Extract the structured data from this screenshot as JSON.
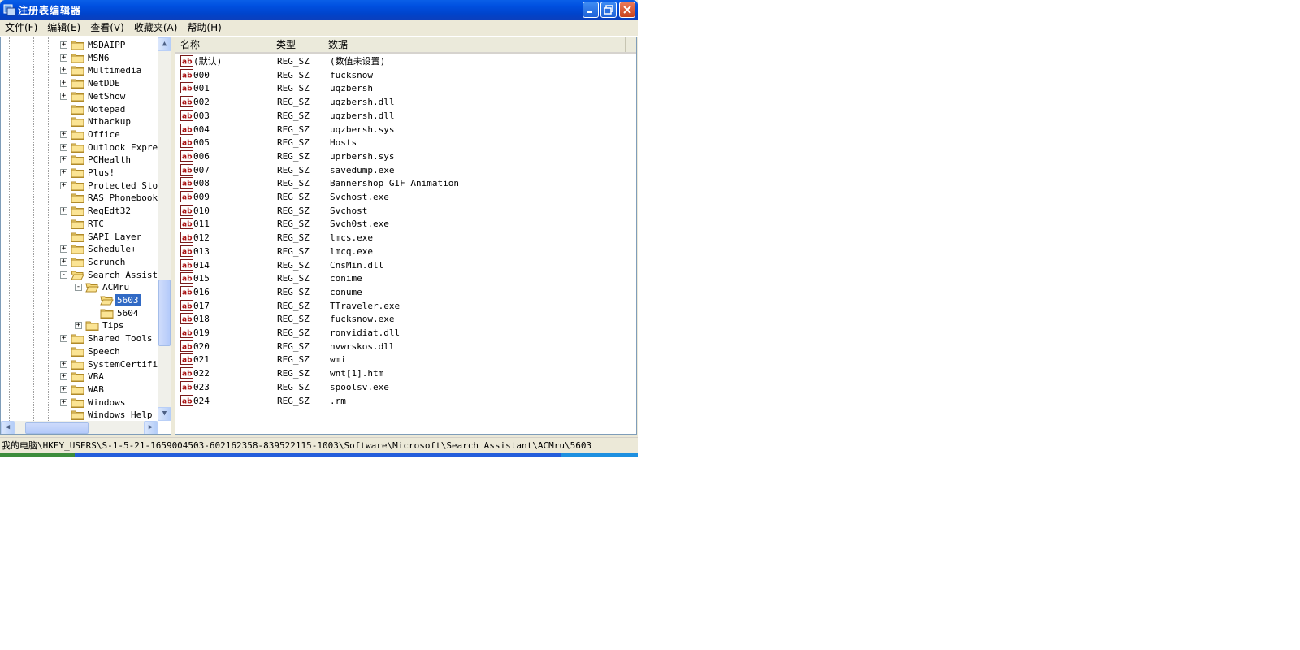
{
  "window": {
    "title": "注册表编辑器"
  },
  "menu": [
    "文件(F)",
    "编辑(E)",
    "查看(V)",
    "收藏夹(A)",
    "帮助(H)"
  ],
  "tree": {
    "items": [
      {
        "label": "MSDAIPP",
        "expander": "+"
      },
      {
        "label": "MSN6",
        "expander": "+"
      },
      {
        "label": "Multimedia",
        "expander": "+"
      },
      {
        "label": "NetDDE",
        "expander": "+"
      },
      {
        "label": "NetShow",
        "expander": "+"
      },
      {
        "label": "Notepad",
        "expander": ""
      },
      {
        "label": "Ntbackup",
        "expander": ""
      },
      {
        "label": "Office",
        "expander": "+"
      },
      {
        "label": "Outlook Express",
        "expander": "+"
      },
      {
        "label": "PCHealth",
        "expander": "+"
      },
      {
        "label": "Plus!",
        "expander": "+"
      },
      {
        "label": "Protected Stor",
        "expander": "+"
      },
      {
        "label": "RAS Phonebook",
        "expander": ""
      },
      {
        "label": "RegEdt32",
        "expander": "+"
      },
      {
        "label": "RTC",
        "expander": ""
      },
      {
        "label": "SAPI Layer",
        "expander": ""
      },
      {
        "label": "Schedule+",
        "expander": "+"
      },
      {
        "label": "Scrunch",
        "expander": "+"
      },
      {
        "label": "Search Assistant",
        "expander": "-"
      },
      {
        "label": "ACMru",
        "expander": "-"
      },
      {
        "label": "5603",
        "expander": "",
        "selected": true
      },
      {
        "label": "5604",
        "expander": ""
      },
      {
        "label": "Tips",
        "expander": "+"
      },
      {
        "label": "Shared Tools",
        "expander": "+"
      },
      {
        "label": "Speech",
        "expander": ""
      },
      {
        "label": "SystemCertificates",
        "expander": "+"
      },
      {
        "label": "VBA",
        "expander": "+"
      },
      {
        "label": "WAB",
        "expander": "+"
      },
      {
        "label": "Windows",
        "expander": "+"
      },
      {
        "label": "Windows Help",
        "expander": ""
      }
    ]
  },
  "list": {
    "columns": [
      "名称",
      "类型",
      "数据"
    ],
    "rows": [
      {
        "name": "(默认)",
        "type": "REG_SZ",
        "data": "(数值未设置)"
      },
      {
        "name": "000",
        "type": "REG_SZ",
        "data": "fucksnow"
      },
      {
        "name": "001",
        "type": "REG_SZ",
        "data": "uqzbersh"
      },
      {
        "name": "002",
        "type": "REG_SZ",
        "data": "uqzbersh.dll"
      },
      {
        "name": "003",
        "type": "REG_SZ",
        "data": "uqzbersh.dll"
      },
      {
        "name": "004",
        "type": "REG_SZ",
        "data": "uqzbersh.sys"
      },
      {
        "name": "005",
        "type": "REG_SZ",
        "data": "Hosts"
      },
      {
        "name": "006",
        "type": "REG_SZ",
        "data": "uprbersh.sys"
      },
      {
        "name": "007",
        "type": "REG_SZ",
        "data": "savedump.exe"
      },
      {
        "name": "008",
        "type": "REG_SZ",
        "data": "Bannershop GIF Animation"
      },
      {
        "name": "009",
        "type": "REG_SZ",
        "data": "Svchost.exe"
      },
      {
        "name": "010",
        "type": "REG_SZ",
        "data": "Svchost"
      },
      {
        "name": "011",
        "type": "REG_SZ",
        "data": "Svch0st.exe"
      },
      {
        "name": "012",
        "type": "REG_SZ",
        "data": "lmcs.exe"
      },
      {
        "name": "013",
        "type": "REG_SZ",
        "data": "lmcq.exe"
      },
      {
        "name": "014",
        "type": "REG_SZ",
        "data": "CnsMin.dll"
      },
      {
        "name": "015",
        "type": "REG_SZ",
        "data": "conime"
      },
      {
        "name": "016",
        "type": "REG_SZ",
        "data": "conume"
      },
      {
        "name": "017",
        "type": "REG_SZ",
        "data": "TTraveler.exe"
      },
      {
        "name": "018",
        "type": "REG_SZ",
        "data": "fucksnow.exe"
      },
      {
        "name": "019",
        "type": "REG_SZ",
        "data": "ronvidiat.dll"
      },
      {
        "name": "020",
        "type": "REG_SZ",
        "data": "nvwrskos.dll"
      },
      {
        "name": "021",
        "type": "REG_SZ",
        "data": "wmi"
      },
      {
        "name": "022",
        "type": "REG_SZ",
        "data": "wnt[1].htm"
      },
      {
        "name": "023",
        "type": "REG_SZ",
        "data": "spoolsv.exe"
      },
      {
        "name": "024",
        "type": "REG_SZ",
        "data": ".rm"
      }
    ]
  },
  "status": {
    "path": "我的电脑\\HKEY_USERS\\S-1-5-21-1659004503-602162358-839522115-1003\\Software\\Microsoft\\Search Assistant\\ACMru\\5603"
  },
  "icons": {
    "value": "string-value-icon",
    "folder": "folder-icon"
  },
  "colors": {
    "selection": "#316ac5",
    "titlebar": "#0050e0"
  }
}
